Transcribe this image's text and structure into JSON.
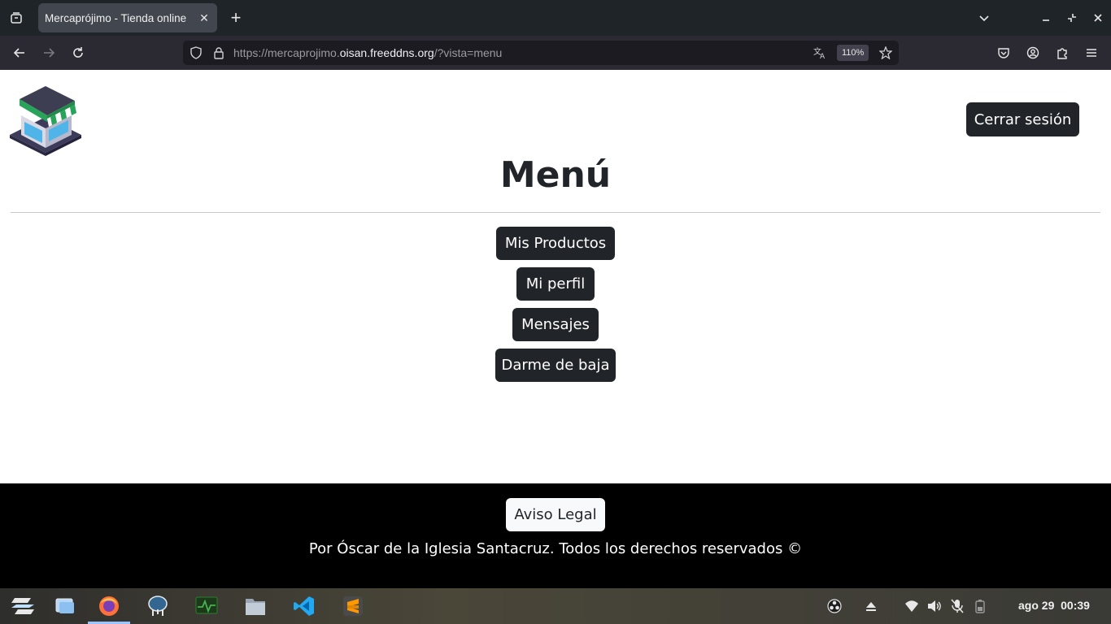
{
  "browser": {
    "tab_title": "Mercaprójimo - Tienda online",
    "url_prefix": "https://mercaprojimo.",
    "url_host": "oisan.freeddns.org",
    "url_suffix": "/?vista=menu",
    "zoom": "110%"
  },
  "page": {
    "logout_label": "Cerrar sesión",
    "title": "Menú",
    "menu": [
      {
        "label": "Mis Productos"
      },
      {
        "label": "Mi perfil"
      },
      {
        "label": "Mensajes"
      },
      {
        "label": "Darme de baja"
      }
    ],
    "footer": {
      "legal_label": "Aviso Legal",
      "copyright": "Por Óscar de la Iglesia Santacruz. Todos los derechos reservados ©"
    }
  },
  "taskbar": {
    "date": "ago 29",
    "time": "00:39"
  },
  "colors": {
    "dark_button": "#212529",
    "footer_bg": "#000000"
  }
}
